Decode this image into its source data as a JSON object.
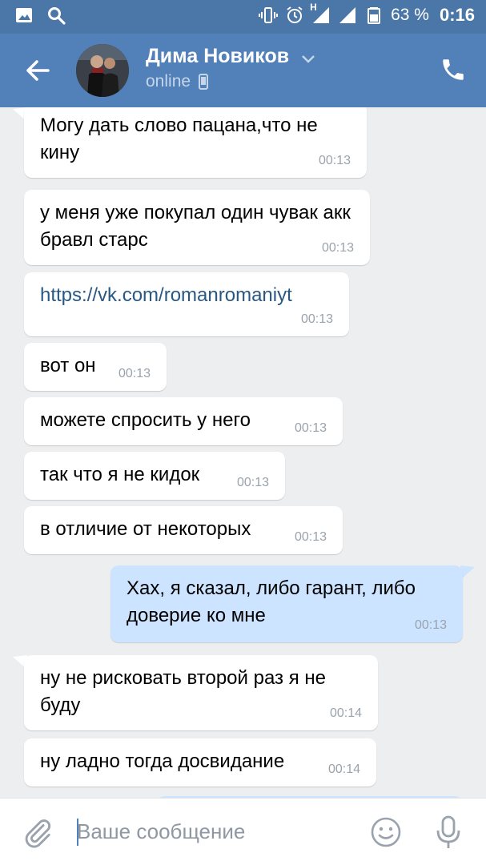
{
  "status_bar": {
    "icons": [
      "gallery-icon",
      "search-icon",
      "vibrate-icon",
      "alarm-icon",
      "signal-h-icon",
      "signal-icon",
      "battery-icon"
    ],
    "network_label": "H",
    "battery": "63 %",
    "time": "0:16"
  },
  "header": {
    "contact_name": "Дима Новиков",
    "status": "online",
    "colors": {
      "toolbar": "#5181b8",
      "statusbar": "#4a76a8"
    }
  },
  "messages": [
    {
      "dir": "in",
      "text": "Могу дать слово пацана,что не кину",
      "time": "00:13"
    },
    {
      "dir": "in",
      "text": "у меня уже покупал один чувак акк бравл старс",
      "time": "00:13"
    },
    {
      "dir": "in",
      "text": "https://vk.com/romanromaniyt",
      "time": "00:13",
      "is_link": true
    },
    {
      "dir": "in",
      "text": "вот он",
      "time": "00:13"
    },
    {
      "dir": "in",
      "text": "можете спросить у него",
      "time": "00:13"
    },
    {
      "dir": "in",
      "text": "так что я не кидок",
      "time": "00:13"
    },
    {
      "dir": "in",
      "text": "в отличие от некоторых",
      "time": "00:13"
    },
    {
      "dir": "out",
      "text": "Хах, я сказал, либо гарант, либо доверие ко мне",
      "time": "00:13"
    },
    {
      "dir": "in",
      "text": "ну не рисковать второй раз я не буду",
      "time": "00:14"
    },
    {
      "dir": "in",
      "text": "ну ладно тогда досвидание",
      "time": "00:14"
    }
  ],
  "composer": {
    "placeholder": "Ваше сообщение"
  }
}
